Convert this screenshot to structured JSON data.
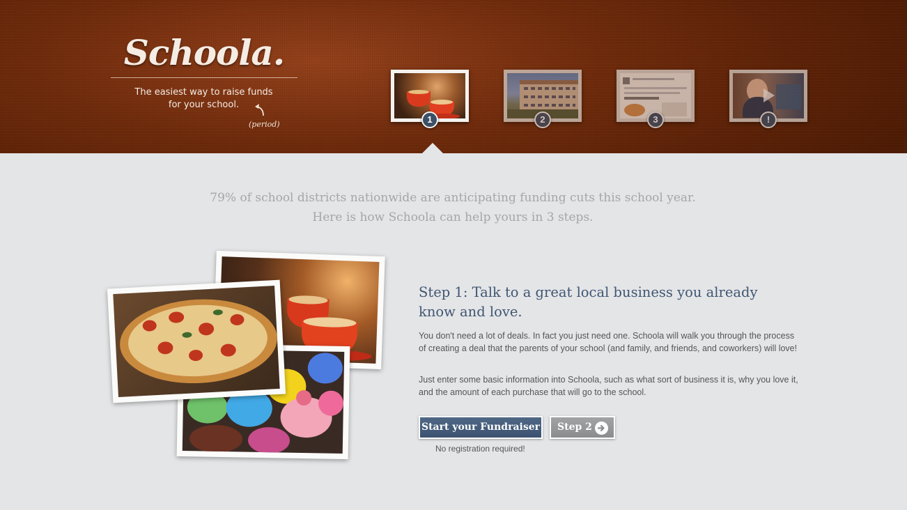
{
  "header": {
    "logo": "Schoola.",
    "tagline": "The easiest way to raise funds for your school.",
    "period_note": "(period)",
    "steps": [
      {
        "badge": "1",
        "label": "coffee-thumbnail"
      },
      {
        "badge": "2",
        "label": "school-building-thumbnail"
      },
      {
        "badge": "3",
        "label": "deal-page-thumbnail"
      },
      {
        "badge": "!",
        "label": "video-thumbnail"
      }
    ]
  },
  "intro": {
    "line1": "79% of school districts nationwide are anticipating funding cuts this school year.",
    "line2": "Here is how Schoola can help yours in 3 steps."
  },
  "step": {
    "title": "Step 1: Talk to a great local business you already know and love.",
    "p1": "You don't need a lot of deals. In fact you just need one. Schoola will walk you through the process of creating a deal that the parents of your school (and family, and friends, and coworkers) will love!",
    "p2": "Just enter some basic information into Schoola, such as what sort of business it is, why you love it, and the amount of each purchase that will go to the school.",
    "primary_button": "Start your Fundraiser",
    "secondary_button": "Step 2",
    "note": "No registration required!"
  },
  "colors": {
    "header_wood": "#6e2a0b",
    "badge": "#3c4f66",
    "title": "#3f5672",
    "primary_button": "#46607e",
    "secondary_button": "#969799",
    "background": "#e4e5e7"
  }
}
